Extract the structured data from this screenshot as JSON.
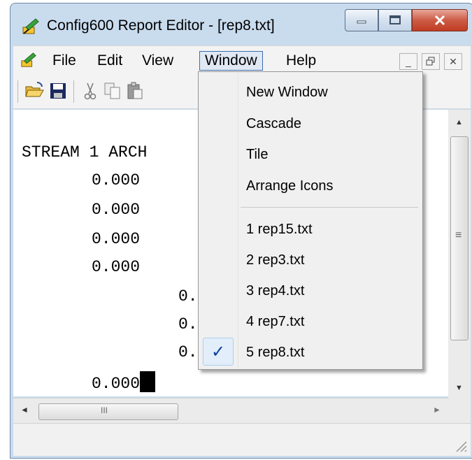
{
  "window": {
    "title": "Config600 Report Editor - [rep8.txt]",
    "app_icon": "config600-app-icon",
    "caption_buttons": [
      "minimize-icon",
      "maximize-icon",
      "close-icon"
    ]
  },
  "menubar": {
    "items": [
      {
        "label": "File"
      },
      {
        "label": "Edit"
      },
      {
        "label": "View"
      },
      {
        "label": "Window"
      },
      {
        "label": "Help"
      }
    ],
    "active": "Window",
    "mdi_buttons": [
      "mdi-minimize-icon",
      "mdi-restore-icon",
      "mdi-close-icon"
    ]
  },
  "toolbar": {
    "buttons": [
      "open-folder-icon",
      "save-icon",
      "cut-icon",
      "copy-icon",
      "paste-icon"
    ]
  },
  "document": {
    "lines": [
      "STREAM 1 ARCH",
      "0.000",
      "0.000",
      "0.000",
      "0.000",
      "0.",
      "0.",
      "0.",
      "0.000"
    ]
  },
  "window_menu": {
    "items": [
      {
        "label": "New Window"
      },
      {
        "label": "Cascade"
      },
      {
        "label": "Tile"
      },
      {
        "label": "Arrange Icons"
      }
    ],
    "files": [
      {
        "label": "1 rep15.txt",
        "checked": false
      },
      {
        "label": "2 rep3.txt",
        "checked": false
      },
      {
        "label": "3 rep4.txt",
        "checked": false
      },
      {
        "label": "4 rep7.txt",
        "checked": false
      },
      {
        "label": "5 rep8.txt",
        "checked": true
      }
    ],
    "check_glyph": "✓"
  },
  "scrollbar_glyphs": {
    "up": "▲",
    "down": "▼",
    "left": "◄",
    "right": "►",
    "grip": "≡",
    "hgrip": "III"
  },
  "colors": {
    "titlebar": "#c9dcee",
    "menu_bg": "#f0f0f0",
    "active_menu_border": "#3d6db0",
    "close_button": "#c13c22",
    "check": "#0c3d9b"
  }
}
